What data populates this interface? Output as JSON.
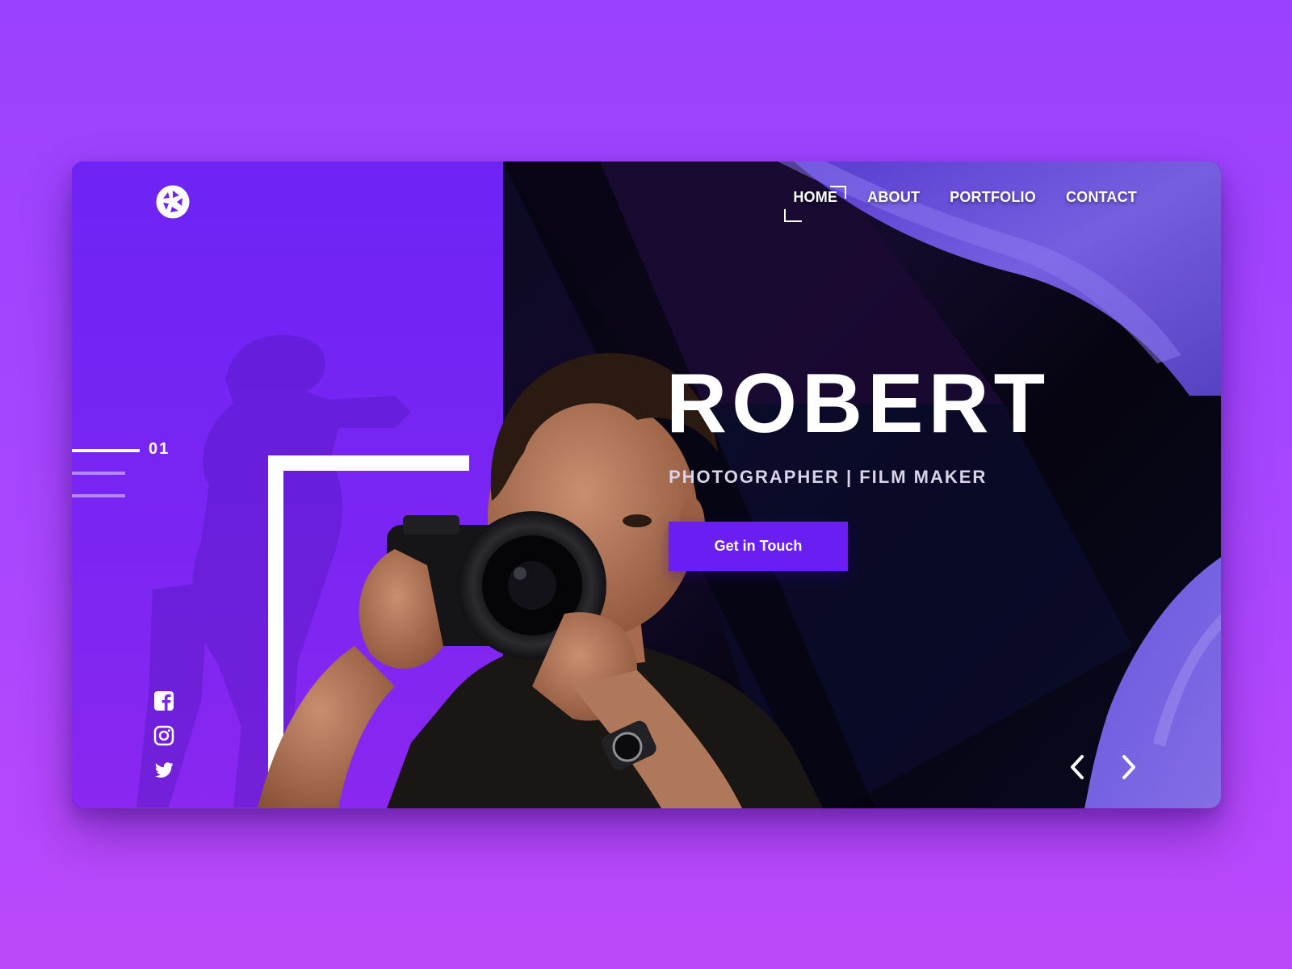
{
  "brand": {
    "logo_icon": "camera-aperture-icon"
  },
  "nav": {
    "items": [
      {
        "label": "HOME",
        "active": true
      },
      {
        "label": "ABOUT",
        "active": false
      },
      {
        "label": "PORTFOLIO",
        "active": false
      },
      {
        "label": "CONTACT",
        "active": false
      }
    ]
  },
  "hero": {
    "name": "ROBERT",
    "subtitle": "PHOTOGRAPHER | FILM MAKER",
    "cta_label": "Get in Touch"
  },
  "slider": {
    "current": "01",
    "prev_icon": "chevron-left-icon",
    "next_icon": "chevron-right-icon"
  },
  "social": {
    "icons": [
      "facebook-icon",
      "instagram-icon",
      "twitter-icon"
    ]
  },
  "colors": {
    "page_background": "#a546ff",
    "left_panel": "#6d24f5",
    "accent": "#6a1ff2",
    "dark_panel": "#070418",
    "text": "#ffffff"
  }
}
